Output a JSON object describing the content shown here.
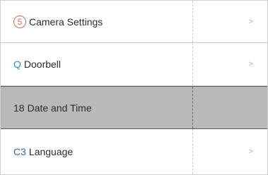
{
  "menu": {
    "items": [
      {
        "prefix": "5",
        "label": "Camera Settings",
        "arrow": ">"
      },
      {
        "prefix": "Q",
        "label": "Doorbell",
        "arrow": ">"
      },
      {
        "prefix": "18",
        "label": "Date and Time",
        "arrow": ""
      },
      {
        "prefix": "C3",
        "label": "Language",
        "arrow": ">"
      }
    ],
    "selected_index": 2
  },
  "colors": {
    "selected_background": "#b9b9b9",
    "camera_badge": "#e0645a",
    "doorbell_icon": "#2d8fd5",
    "language_icon": "#2d6fa8"
  }
}
